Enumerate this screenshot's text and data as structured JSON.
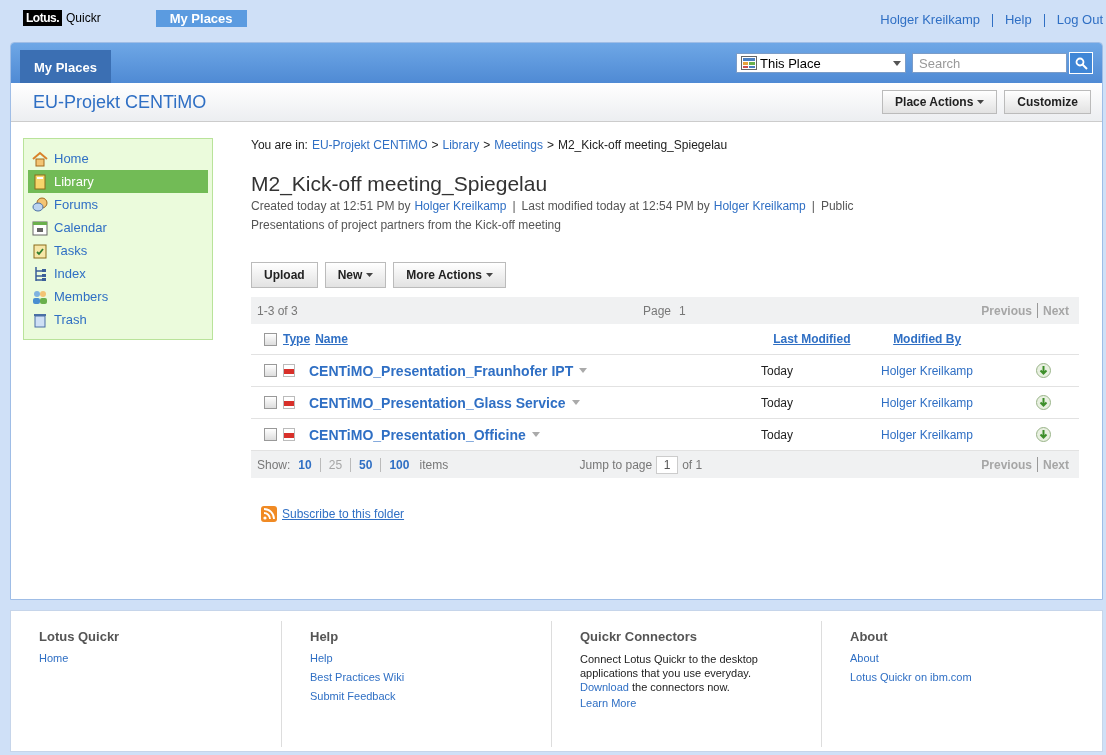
{
  "top_bar": {
    "logo_brand": "Lotus.",
    "logo_product": "Quickr",
    "tab": "My Places",
    "user": "Holger Kreilkamp",
    "links": [
      "Help",
      "Log Out"
    ]
  },
  "header": {
    "tab": "My Places",
    "scope": "This Place",
    "search": {
      "placeholder": "Search"
    }
  },
  "place": {
    "title": "EU-Projekt CENTiMO",
    "buttons": [
      {
        "label": "Place Actions",
        "menu": true
      },
      {
        "label": "Customize",
        "menu": false
      }
    ]
  },
  "sidebar": {
    "items": [
      {
        "label": "Home",
        "selected": false
      },
      {
        "label": "Library",
        "selected": true
      },
      {
        "label": "Forums",
        "selected": false
      },
      {
        "label": "Calendar",
        "selected": false
      },
      {
        "label": "Tasks",
        "selected": false
      },
      {
        "label": "Index",
        "selected": false
      },
      {
        "label": "Members",
        "selected": false
      },
      {
        "label": "Trash",
        "selected": false
      }
    ]
  },
  "breadcrumb": {
    "prefix": "You are in:",
    "links": [
      "EU-Projekt CENTiMO",
      "Library",
      "Meetings"
    ],
    "current": "M2_Kick-off meeting_Spiegelau",
    "separator": ">"
  },
  "folder": {
    "title": "M2_Kick-off meeting_Spiegelau",
    "meta": [
      {
        "kind": "text",
        "text": "Created today at 12:51 PM by"
      },
      {
        "kind": "link",
        "text": "Holger Kreilkamp"
      },
      {
        "kind": "sep",
        "text": "|"
      },
      {
        "kind": "text",
        "text": "Last modified today at 12:54 PM by"
      },
      {
        "kind": "link",
        "text": "Holger Kreilkamp"
      },
      {
        "kind": "sep",
        "text": "|"
      },
      {
        "kind": "text",
        "text": "Public"
      }
    ],
    "description": "Presentations of project partners from the Kick-off meeting"
  },
  "actions": [
    {
      "label": "Upload",
      "menu": false
    },
    {
      "label": "New",
      "menu": true
    },
    {
      "label": "More Actions",
      "menu": true
    }
  ],
  "table": {
    "count": "1-3 of 3",
    "page_label": "Page",
    "page": "1",
    "previous": "Previous",
    "next": "Next",
    "select_all_checked": false,
    "columns": [
      "Type",
      "Name",
      "Last Modified",
      "Modified By"
    ],
    "rows": [
      {
        "checked": false,
        "name": "CENTiMO_Presentation_Fraunhofer IPT",
        "modified": "Today",
        "by": "Holger Kreilkamp"
      },
      {
        "checked": false,
        "name": "CENTiMO_Presentation_Glass Service",
        "modified": "Today",
        "by": "Holger Kreilkamp"
      },
      {
        "checked": false,
        "name": "CENTiMO_Presentation_Officine",
        "modified": "Today",
        "by": "Holger Kreilkamp"
      }
    ],
    "show_label": "Show:",
    "sizes": [
      {
        "label": "10",
        "disabled": false
      },
      {
        "label": "25",
        "disabled": true
      },
      {
        "label": "50",
        "disabled": false
      },
      {
        "label": "100",
        "disabled": false
      }
    ],
    "items_label": "items",
    "jump_label": "Jump to page",
    "jump_value": "1",
    "of_total": "of 1",
    "bottom_previous": "Previous",
    "bottom_next": "Next"
  },
  "subscribe": "Subscribe to this folder",
  "footer": [
    {
      "title": "Lotus Quickr",
      "links": [
        "Home"
      ]
    },
    {
      "title": "Help",
      "links": [
        "Help",
        "Best Practices Wiki",
        "Submit Feedback"
      ]
    },
    {
      "title": "Quickr Connectors",
      "text_before": "Connect Lotus Quickr to the desktop applications that you use everyday.",
      "text_link": "Download",
      "text_after": "the connectors now.",
      "links": [
        "Learn More"
      ]
    },
    {
      "title": "About",
      "links": [
        "About",
        "Lotus Quickr on ibm.com"
      ]
    }
  ]
}
